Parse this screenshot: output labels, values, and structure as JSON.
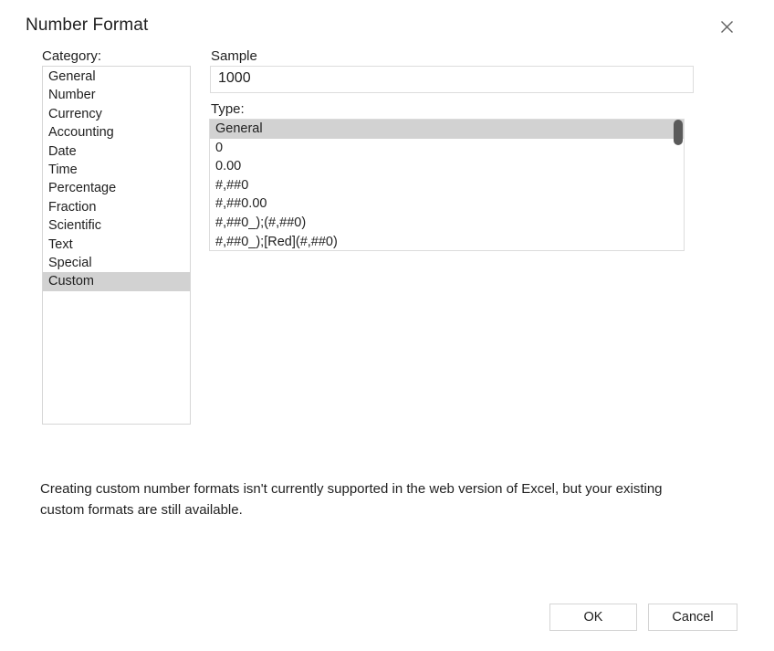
{
  "dialog": {
    "title": "Number Format",
    "close_icon": "close-icon"
  },
  "category": {
    "label": "Category:",
    "items": [
      "General",
      "Number",
      "Currency",
      "Accounting",
      "Date",
      "Time",
      "Percentage",
      "Fraction",
      "Scientific",
      "Text",
      "Special",
      "Custom"
    ],
    "selected": "Custom",
    "selected_index": 11
  },
  "sample": {
    "label": "Sample",
    "value": "1000"
  },
  "type": {
    "label": "Type:",
    "items": [
      "General",
      "0",
      "0.00",
      "#,##0",
      "#,##0.00",
      "#,##0_);(#,##0)",
      "#,##0_);[Red](#,##0)"
    ],
    "selected": "General",
    "selected_index": 0,
    "scrollbar": {
      "thumb_position": "top"
    }
  },
  "footer": {
    "note": "Creating custom number formats isn't currently supported in the web version of Excel, but your existing custom formats are still available."
  },
  "buttons": {
    "ok": "OK",
    "cancel": "Cancel"
  },
  "colors": {
    "selection": "#d2d2d2",
    "border": "#dcdcdc",
    "text": "#1f1f1f",
    "scroll_thumb": "#5a5a5a",
    "background": "#ffffff"
  }
}
